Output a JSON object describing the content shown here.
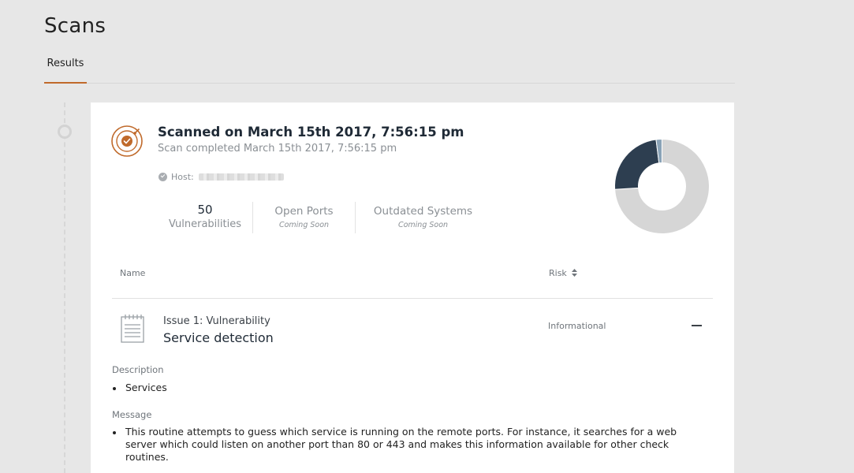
{
  "page": {
    "title": "Scans"
  },
  "tabs": [
    {
      "label": "Results",
      "active": true
    }
  ],
  "scan": {
    "title": "Scanned on March 15th 2017, 7:56:15 pm",
    "subtitle": "Scan completed March 15th 2017, 7:56:15 pm",
    "host_label": "Host:",
    "stats": {
      "vulnerabilities": {
        "value": "50",
        "label": "Vulnerabilities"
      },
      "open_ports": {
        "label": "Open Ports",
        "status": "Coming Soon"
      },
      "outdated_systems": {
        "label": "Outdated Systems",
        "status": "Coming Soon"
      }
    }
  },
  "donut": {
    "segments": [
      {
        "fraction": 0.74,
        "color": "#d6d6d6"
      },
      {
        "fraction": 0.24,
        "color": "#2d3e50"
      },
      {
        "fraction": 0.02,
        "color": "#8aa3b7"
      }
    ]
  },
  "table": {
    "columns": {
      "name": "Name",
      "risk": "Risk"
    }
  },
  "issue": {
    "number_label": "Issue 1: Vulnerability",
    "title": "Service detection",
    "risk": "Informational",
    "description_label": "Description",
    "description_items": [
      "Services"
    ],
    "message_label": "Message",
    "message_lines": [
      "This routine attempts to guess which service is running on the remote ports. For instance, it searches for a web",
      "server which could listen on another port than 80 or 443 and makes this information available for other check",
      "routines."
    ]
  },
  "colors": {
    "accent": "#c06a2b",
    "dark": "#2d3e50",
    "muted": "#8a8f94"
  },
  "icons": {
    "scan": "radar-check-icon",
    "issue": "notepad-icon",
    "sort": "sort-icon",
    "collapse": "minus-icon",
    "host_status": "check-circle-icon"
  }
}
